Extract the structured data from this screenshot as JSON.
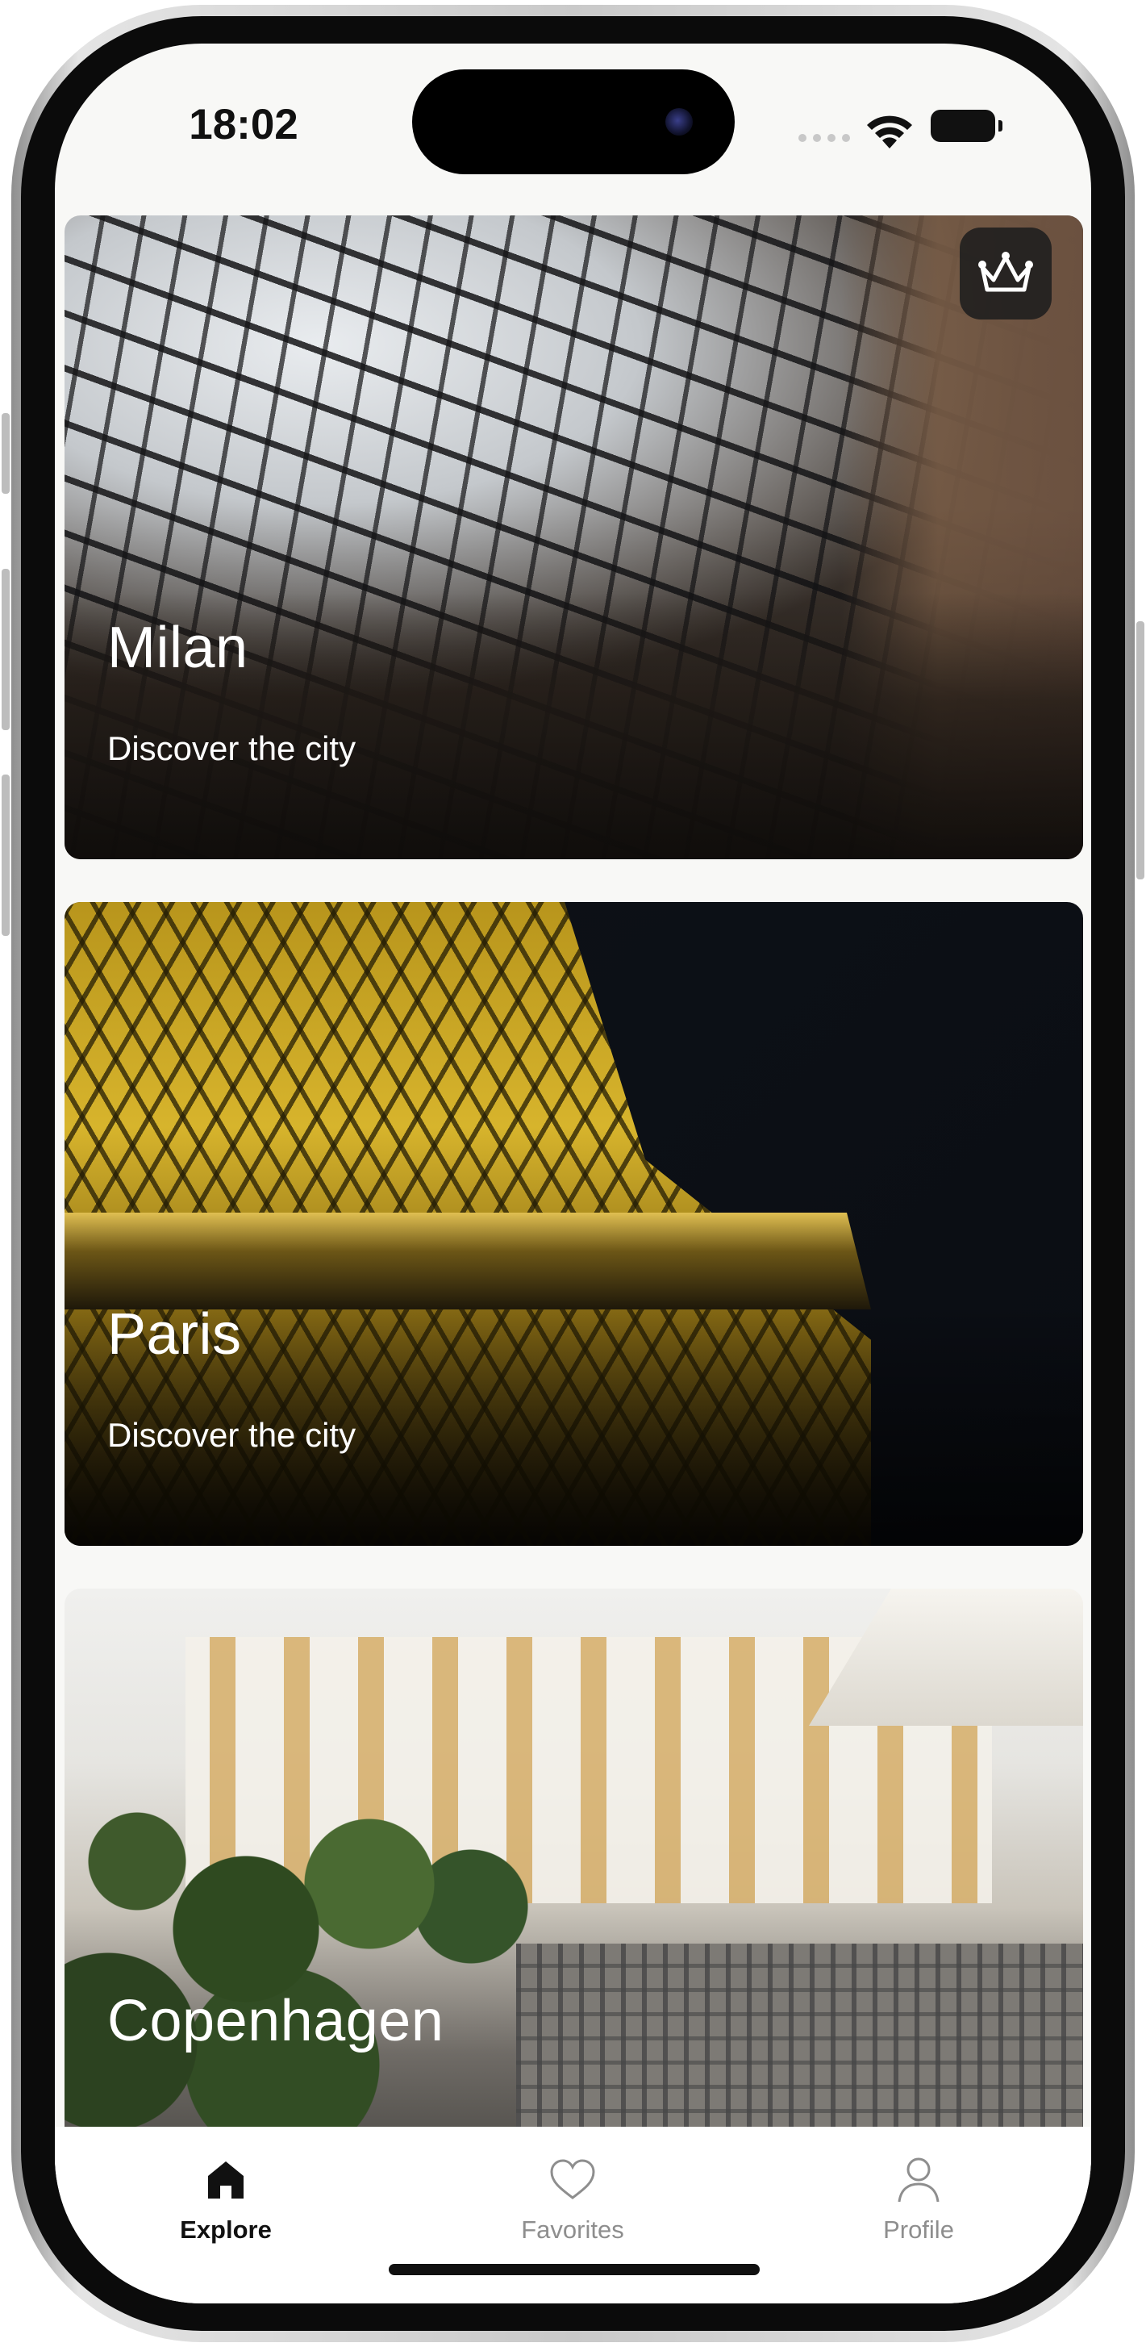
{
  "status": {
    "time": "18:02"
  },
  "cards": [
    {
      "title": "Milan",
      "subtitle": "Discover the city"
    },
    {
      "title": "Paris",
      "subtitle": "Discover the city"
    },
    {
      "title": "Copenhagen",
      "subtitle": ""
    }
  ],
  "premium_icon": "crown-icon",
  "tabs": [
    {
      "label": "Explore",
      "icon": "house-icon",
      "active": true
    },
    {
      "label": "Favorites",
      "icon": "heart-icon",
      "active": false
    },
    {
      "label": "Profile",
      "icon": "person-icon",
      "active": false
    }
  ],
  "colors": {
    "active_tab": "#111111",
    "inactive_tab": "#8e8e8e",
    "background": "#f8f8f6"
  }
}
